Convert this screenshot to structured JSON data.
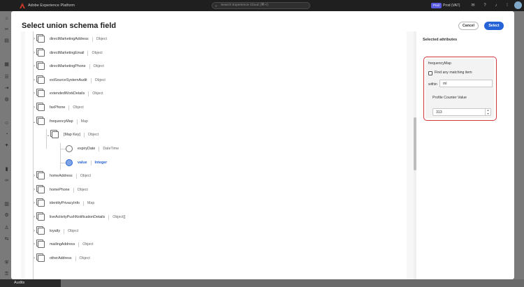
{
  "app": {
    "title": "Adobe Experience Platform",
    "search_placeholder": "Search Experience Cloud (⌘+/)",
    "env_badge": "Prod",
    "sandbox": "Prod (VA7)"
  },
  "bottom_nav": {
    "item": "Audits"
  },
  "dialog": {
    "title": "Select union schema field",
    "cancel_label": "Cancel",
    "select_label": "Select",
    "fields": [
      {
        "name": "directMarketingAddress",
        "type": "Object"
      },
      {
        "name": "directMarketingEmail",
        "type": "Object"
      },
      {
        "name": "directMarketingPhone",
        "type": "Object"
      },
      {
        "name": "extSourceSystemAudit",
        "type": "Object"
      },
      {
        "name": "extendedWorkDetails",
        "type": "Object"
      },
      {
        "name": "faxPhone",
        "type": "Object"
      },
      {
        "name": "frequencyMap",
        "type": "Map"
      },
      {
        "name": "[Map Key]",
        "type": "Object"
      },
      {
        "name": "expiryDate",
        "type": "DateTime"
      },
      {
        "name": "value",
        "type": "Integer"
      },
      {
        "name": "homeAddress",
        "type": "Object"
      },
      {
        "name": "homePhone",
        "type": "Object"
      },
      {
        "name": "identityPrivacyInfo",
        "type": "Map"
      },
      {
        "name": "liveActivityPushNotificationDetails",
        "type": "Object[]"
      },
      {
        "name": "loyalty",
        "type": "Object"
      },
      {
        "name": "mailingAddress",
        "type": "Object"
      },
      {
        "name": "otherAddress",
        "type": "Object"
      }
    ]
  },
  "selected_attributes": {
    "header": "Selected attributes",
    "attribute_name": "frequencyMap",
    "find_any_label": "Find any matching item",
    "find_any_checked": false,
    "within_label": "within",
    "within_value": "ml",
    "value_label": "Profile Counter Value",
    "value": "313"
  }
}
